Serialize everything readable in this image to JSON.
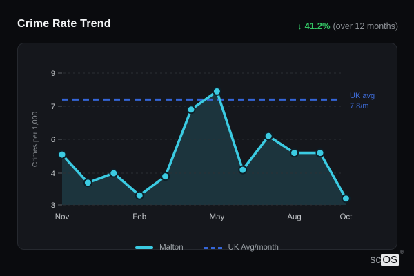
{
  "header": {
    "title": "Crime Rate Trend",
    "change_arrow": "↓",
    "change_value": "41.2%",
    "change_caption": "(over 12 months)"
  },
  "chart_data": {
    "type": "line",
    "title": "Crime Rate Trend",
    "ylabel": "Crimes per 1,000",
    "y_ticks": [
      3,
      4,
      6,
      7,
      9
    ],
    "x_tick_labels": [
      "Nov",
      "Feb",
      "May",
      "Aug",
      "Oct"
    ],
    "x_tick_indices": [
      0,
      3,
      6,
      9,
      11
    ],
    "points_per_series": 12,
    "series": [
      {
        "name": "Malton",
        "values": [
          5.1,
          3.7,
          4.0,
          3.3,
          3.9,
          6.9,
          7.9,
          4.2,
          6.1,
          5.2,
          5.2,
          3.2
        ]
      }
    ],
    "reference_line": {
      "name": "UK Avg/month",
      "label_line1": "UK avg",
      "label_line2": "7.8/m",
      "plotted_value": 7.4
    },
    "grid": "dashed-horizontal",
    "legend_position": "bottom-center",
    "colors": {
      "accent_cyan": "#3bcbe2",
      "reference_blue": "#3566d8",
      "positive_green": "#33c363",
      "area_fill": "#1c343d",
      "card_bg": "#15171c",
      "page_bg": "#0a0b0e"
    }
  },
  "legend": {
    "items": [
      {
        "label": "Malton",
        "swatch": "solid-cyan-line"
      },
      {
        "label": "UK Avg/month",
        "swatch": "dashed-blue-line"
      }
    ]
  },
  "logo": {
    "prefix": "sc",
    "box_text": "OS",
    "registered_mark": "®"
  }
}
